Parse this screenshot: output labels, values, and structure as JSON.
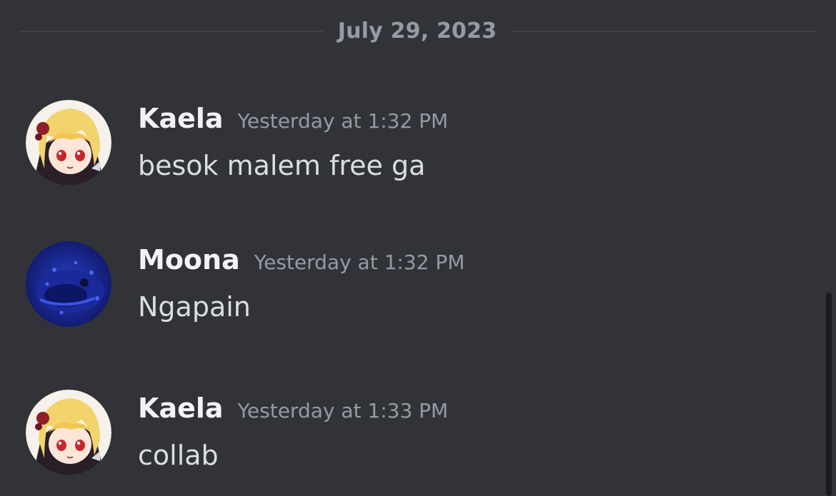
{
  "date_divider": "July 29, 2023",
  "messages": [
    {
      "username": "Kaela",
      "timestamp": "Yesterday at 1:32 PM",
      "text": "besok malem free ga",
      "avatar": "blonde-anime-girl-avatar"
    },
    {
      "username": "Moona",
      "timestamp": "Yesterday at 1:32 PM",
      "text": "Ngapain",
      "avatar": "blue-fish-avatar"
    },
    {
      "username": "Kaela",
      "timestamp": "Yesterday at 1:33 PM",
      "text": "collab",
      "avatar": "blonde-anime-girl-avatar"
    }
  ],
  "colors": {
    "background": "#313338",
    "username": "#f2f3f5",
    "timestamp": "#949ba4",
    "message_text": "#dbdee1",
    "divider": "#3f4147"
  }
}
